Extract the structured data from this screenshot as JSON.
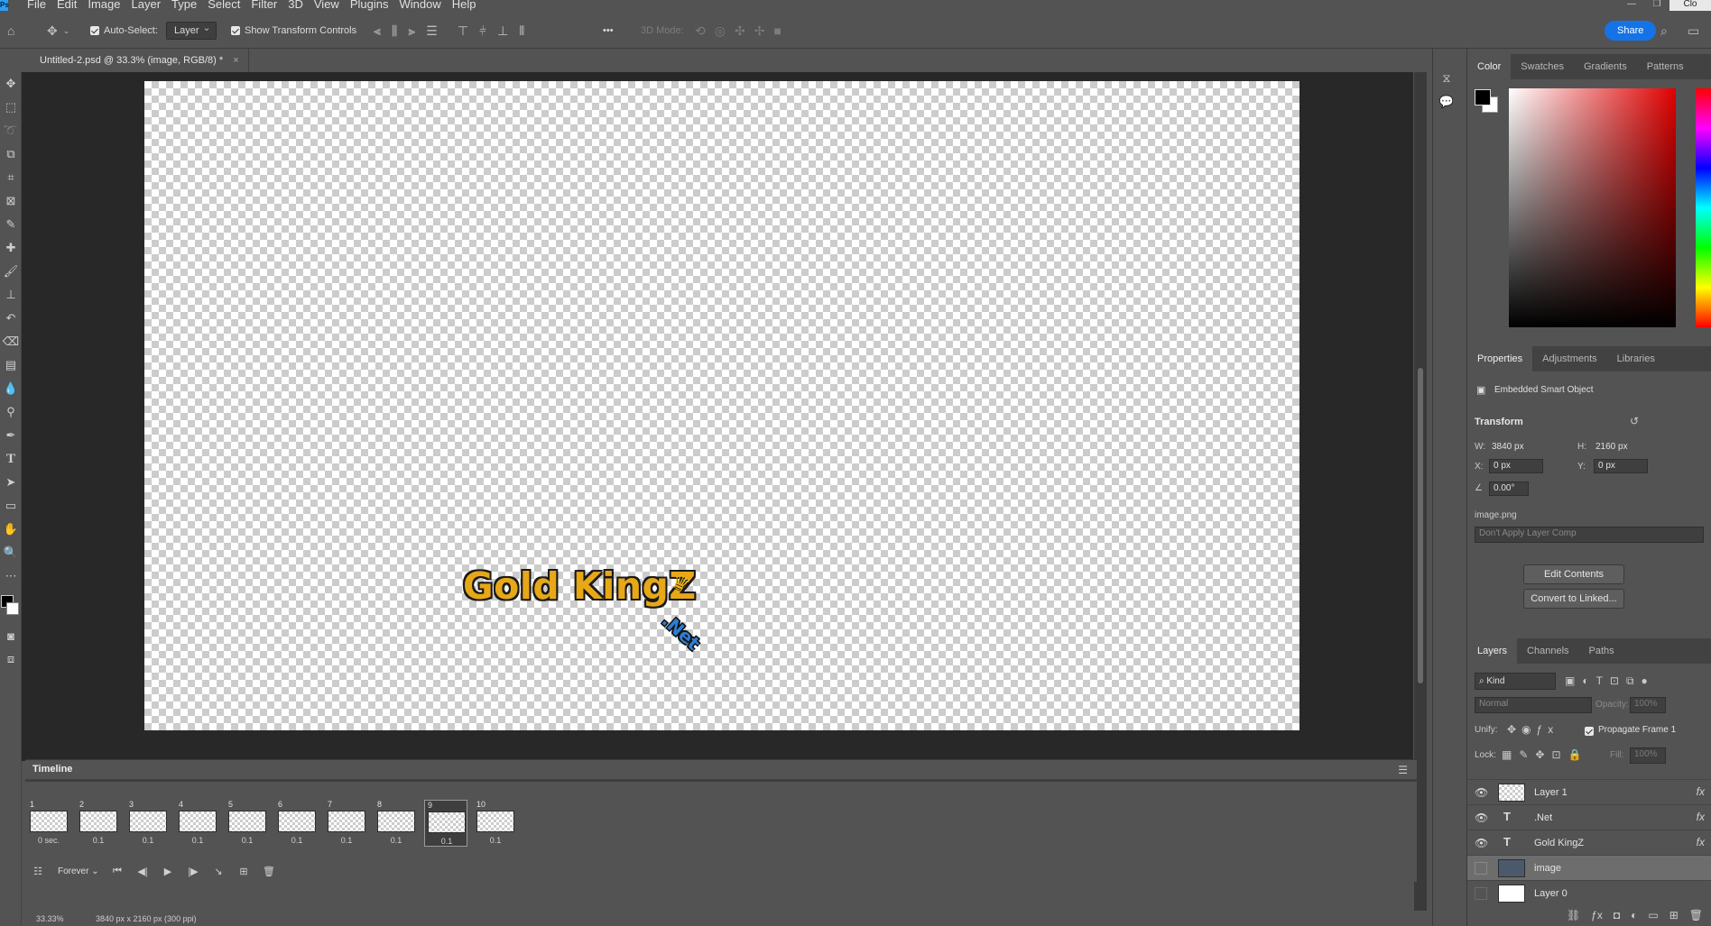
{
  "app": {
    "menu": [
      "File",
      "Edit",
      "Image",
      "Layer",
      "Type",
      "Select",
      "Filter",
      "3D",
      "View",
      "Plugins",
      "Window",
      "Help"
    ],
    "window_buttons": [
      "—",
      "❐",
      "✕"
    ],
    "close_tooltip": "Clo"
  },
  "options_bar": {
    "auto_select_label": "Auto-Select:",
    "auto_select_target": "Layer",
    "show_transform_label": "Show Transform Controls",
    "mode_3d_label": "3D Mode:",
    "share_label": "Share",
    "more_label": "•••"
  },
  "document": {
    "tab_title": "Untitled-2.psd @ 33.3% (image, RGB/8) *",
    "close_glyph": "×",
    "zoom_status": "33.33%",
    "size_status": "3840 px x 2160 px (300 ppi)"
  },
  "canvas": {
    "logo_main": "Gold KingZ",
    "logo_sub": ".Net",
    "logo_crown": "♛"
  },
  "timeline": {
    "title": "Timeline",
    "loop": "Forever",
    "frames": [
      {
        "num": "1",
        "delay": "0 sec."
      },
      {
        "num": "2",
        "delay": "0.1"
      },
      {
        "num": "3",
        "delay": "0.1"
      },
      {
        "num": "4",
        "delay": "0.1"
      },
      {
        "num": "5",
        "delay": "0.1"
      },
      {
        "num": "6",
        "delay": "0.1"
      },
      {
        "num": "7",
        "delay": "0.1"
      },
      {
        "num": "8",
        "delay": "0.1"
      },
      {
        "num": "9",
        "delay": "0.1"
      },
      {
        "num": "10",
        "delay": "0.1"
      }
    ],
    "selected_frame": "9"
  },
  "color_panel": {
    "tabs": [
      "Color",
      "Swatches",
      "Gradients",
      "Patterns"
    ],
    "active_tab": "Color",
    "foreground": "#000000",
    "background": "#ffffff",
    "hue": "#e00000"
  },
  "properties_panel": {
    "tabs": [
      "Properties",
      "Adjustments",
      "Libraries"
    ],
    "object_type": "Embedded Smart Object",
    "section": "Transform",
    "w_label": "W:",
    "w_value": "3840 px",
    "h_label": "H:",
    "h_value": "2160 px",
    "x_label": "X:",
    "x_value": "0 px",
    "y_label": "Y:",
    "y_value": "0 px",
    "angle_value": "0.00°",
    "source_file": "image.png",
    "layer_comp": "Don't Apply Layer Comp",
    "edit_contents": "Edit Contents",
    "convert_linked": "Convert to Linked..."
  },
  "layers_panel": {
    "tabs": [
      "Layers",
      "Channels",
      "Paths"
    ],
    "filter_kind": "Kind",
    "blend_mode": "Normal",
    "opacity_label": "Opacity:",
    "opacity_value": "100%",
    "unify_label": "Unify:",
    "propagate_label": "Propagate Frame 1",
    "lock_label": "Lock:",
    "fill_label": "Fill:",
    "fill_value": "100%",
    "layers": [
      {
        "name": "Layer 1",
        "kind": "pixel",
        "visible": true,
        "fx": "fx"
      },
      {
        "name": ".Net",
        "kind": "text",
        "visible": true,
        "fx": "fx"
      },
      {
        "name": "Gold KingZ",
        "kind": "text",
        "visible": true,
        "fx": "fx"
      },
      {
        "name": "image",
        "kind": "smart",
        "visible": false,
        "fx": ""
      },
      {
        "name": "Layer 0",
        "kind": "pixel",
        "visible": false,
        "fx": ""
      }
    ]
  }
}
